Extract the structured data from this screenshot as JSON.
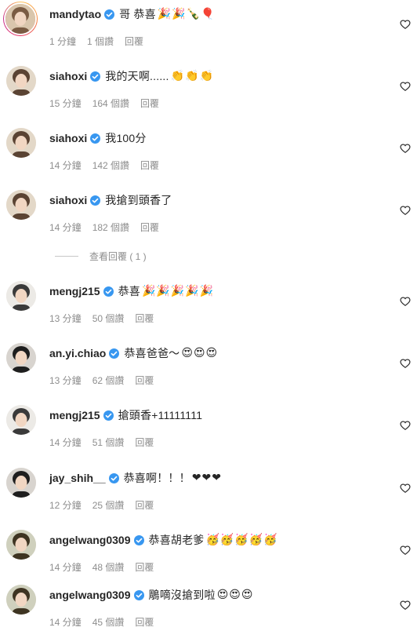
{
  "comments": [
    {
      "user": "mandytao",
      "text": "哥 恭喜",
      "emoji": "🎉🎉🍾🎈",
      "time": "1 分鐘",
      "likes": "1 個讚",
      "reply": "回覆",
      "avatar": "tan"
    },
    {
      "user": "siahoxi",
      "text": "我的天啊......",
      "emoji": "👏👏👏",
      "time": "15 分鐘",
      "likes": "164 個讚",
      "reply": "回覆",
      "avatar": "brown"
    },
    {
      "user": "siahoxi",
      "text": "我100分",
      "emoji": "",
      "time": "14 分鐘",
      "likes": "142 個讚",
      "reply": "回覆",
      "avatar": "brown"
    },
    {
      "user": "siahoxi",
      "text": "我搶到頭香了",
      "emoji": "",
      "time": "14 分鐘",
      "likes": "182 個讚",
      "reply": "回覆",
      "avatar": "brown"
    },
    {
      "user": "mengj215",
      "text": "恭喜",
      "emoji": "🎉🎉🎉🎉🎉",
      "time": "13 分鐘",
      "likes": "50 個讚",
      "reply": "回覆",
      "avatar": "light"
    },
    {
      "user": "an.yi.chiao",
      "text": "恭喜爸爸～",
      "emoji": "😍😍😍",
      "time": "13 分鐘",
      "likes": "62 個讚",
      "reply": "回覆",
      "avatar": "dark"
    },
    {
      "user": "mengj215",
      "text": "搶頭香+11111111",
      "emoji": "",
      "time": "14 分鐘",
      "likes": "51 個讚",
      "reply": "回覆",
      "avatar": "light"
    },
    {
      "user": "jay_shih__",
      "text": "恭喜啊！！！",
      "emoji": "❤❤❤",
      "time": "12 分鐘",
      "likes": "25 個讚",
      "reply": "回覆",
      "avatar": "dark"
    },
    {
      "user": "angelwang0309",
      "text": "恭喜胡老爹",
      "emoji": "🥳🥳🥳🥳🥳",
      "time": "14 分鐘",
      "likes": "48 個讚",
      "reply": "回覆",
      "avatar": "olive"
    },
    {
      "user": "angelwang0309",
      "text": "鵰嘀沒搶到啦",
      "emoji": "😍😍😍",
      "time": "14 分鐘",
      "likes": "45 個讚",
      "reply": "回覆",
      "avatar": "olive"
    }
  ],
  "view_replies": "查看回覆 ( 1 )",
  "colors": {
    "verified": "#3897f0",
    "meta": "#8e8e8e",
    "text": "#262626"
  },
  "icons": {
    "like": "heart-outline-icon",
    "verified": "verified-badge-icon"
  }
}
